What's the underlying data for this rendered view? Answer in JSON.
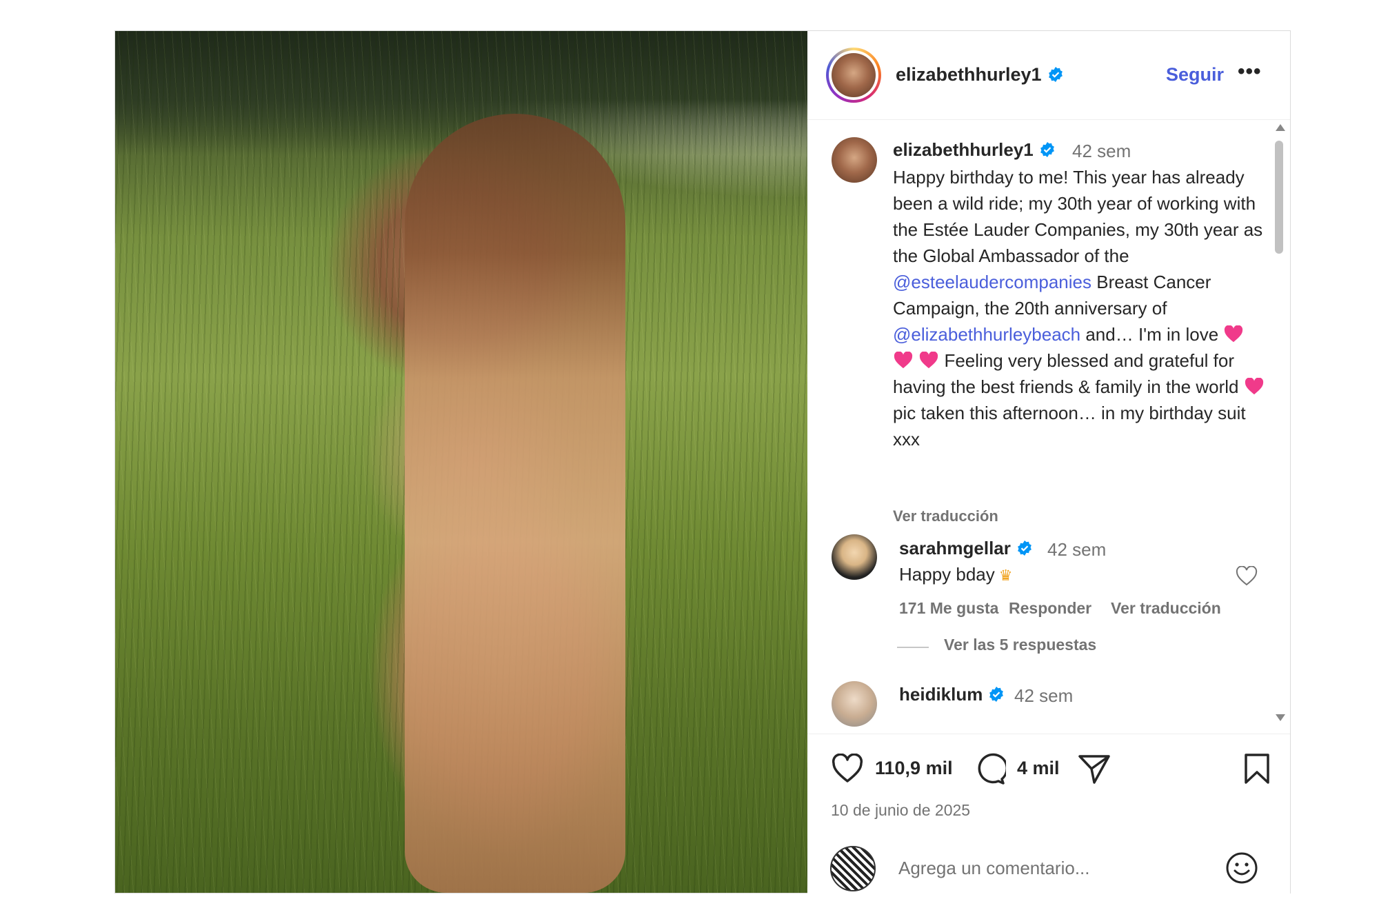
{
  "post": {
    "photo_alt": "",
    "header": {
      "username": "elizabethhurley1",
      "follow_label": "Seguir",
      "more_label": "•••"
    },
    "caption": {
      "username": "elizabethhurley1",
      "time": "42 sem",
      "text_1": "Happy birthday to me! This year has already been a wild ride; my 30th year of working with the Estée Lauder Companies, my 30th year as the Global Ambassador of the ",
      "mention_1": "@esteelaudercompanies",
      "text_2": " Breast Cancer Campaign, the 20th anniversary of ",
      "mention_2": "@elizabethhurleybeach",
      "text_3": " and… I'm in love ",
      "text_4": " Feeling very blessed and grateful for having the best friends & family in the world ",
      "text_5": " pic taken this afternoon… in my birthday suit xxx",
      "translate_label": "Ver traducción"
    },
    "comments": [
      {
        "username": "sarahmgellar",
        "time": "42 sem",
        "text": "Happy bday",
        "emoji": "crown",
        "likes_label": "171 Me gusta",
        "reply_label": "Responder",
        "translate_label": "Ver traducción",
        "replies_label": "Ver las 5 respuestas"
      },
      {
        "username": "heidiklum",
        "time": "42 sem"
      }
    ],
    "actions": {
      "likes": "110,9 mil",
      "comments": "4 mil",
      "date": "10 de junio de 2025"
    },
    "comment_box": {
      "placeholder": "Agrega un comentario..."
    },
    "colors": {
      "link": "#4a5edb",
      "verified": "#0095f6",
      "heart_emoji": "#f03a8a",
      "muted": "#737373"
    }
  }
}
